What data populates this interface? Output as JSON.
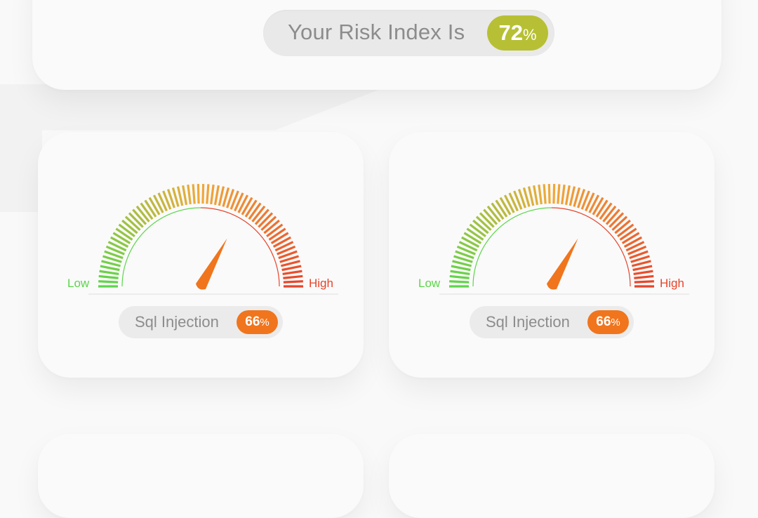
{
  "risk_index": {
    "label": "Your Risk Index Is",
    "value": "72",
    "unit": "%",
    "badge_color": "#b7c034"
  },
  "gauges": [
    {
      "low_label": "Low",
      "high_label": "High",
      "name": "Sql Injection",
      "value": "66",
      "unit": "%",
      "level": 0.66
    },
    {
      "low_label": "Low",
      "high_label": "High",
      "name": "Sql Injection",
      "value": "66",
      "unit": "%",
      "level": 0.66
    }
  ],
  "colors": {
    "low": "#5cd64a",
    "mid": "#f0a93a",
    "high": "#e8442a",
    "needle": "#f0751d",
    "gauge_badge": "#f0751d"
  }
}
